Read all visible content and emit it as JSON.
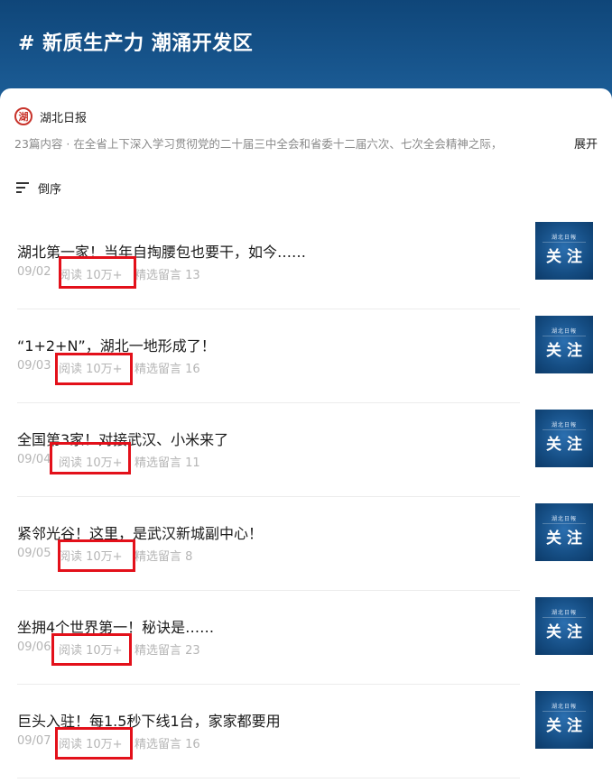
{
  "header": {
    "title": "# 新质生产力 潮涌开发区"
  },
  "source": {
    "logo_char": "湖",
    "name": "湖北日报",
    "description": "23篇内容 · 在全省上下深入学习贯彻党的二十届三中全会和省委十二届六次、七次全会精神之际，",
    "expand_label": "展开"
  },
  "sort": {
    "label": "倒序"
  },
  "thumb": {
    "top_text": "湖北日報",
    "main_text": "关注"
  },
  "articles": [
    {
      "title": "湖北第一家！当年自掏腰包也要干，如今……",
      "date": "09/02",
      "reads": "阅读 10万+",
      "comments": "精选留言 13"
    },
    {
      "title": "“1+2+N”，湖北一地形成了！",
      "date": "09/03",
      "reads": "阅读 10万+",
      "comments": "精选留言 16"
    },
    {
      "title": "全国第3家！对接武汉、小米来了",
      "date": "09/04",
      "reads": "阅读 10万+",
      "comments": "精选留言 11"
    },
    {
      "title": "紧邻光谷！这里，是武汉新城副中心！",
      "date": "09/05",
      "reads": "阅读 10万+",
      "comments": "精选留言 8"
    },
    {
      "title": "坐拥4个世界第一！秘诀是……",
      "date": "09/06",
      "reads": "阅读 10万+",
      "comments": "精选留言 23"
    },
    {
      "title": "巨头入驻！每1.5秒下线1台，家家都要用",
      "date": "09/07",
      "reads": "阅读 10万+",
      "comments": "精选留言 16"
    }
  ]
}
